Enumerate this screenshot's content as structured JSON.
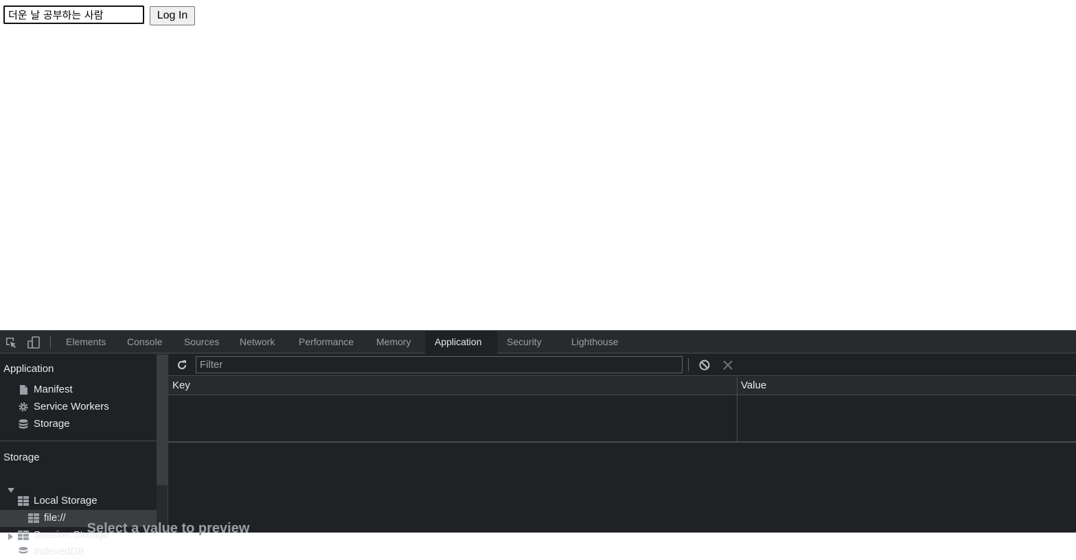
{
  "page": {
    "name_input_value": "더운 날 공부하는 사람",
    "login_button_label": "Log In"
  },
  "devtools": {
    "tabs": [
      {
        "label": "Elements",
        "active": false
      },
      {
        "label": "Console",
        "active": false
      },
      {
        "label": "Sources",
        "active": false
      },
      {
        "label": "Network",
        "active": false
      },
      {
        "label": "Performance",
        "active": false
      },
      {
        "label": "Memory",
        "active": false
      },
      {
        "label": "Application",
        "active": true
      },
      {
        "label": "Security",
        "active": false
      },
      {
        "label": "Lighthouse",
        "active": false
      }
    ],
    "sidebar": {
      "application_header": "Application",
      "application_items": [
        {
          "label": "Manifest",
          "icon": "document-icon"
        },
        {
          "label": "Service Workers",
          "icon": "gear-icon"
        },
        {
          "label": "Storage",
          "icon": "database-icon"
        }
      ],
      "storage_header": "Storage",
      "storage_items": [
        {
          "label": "Local Storage",
          "icon": "table-icon",
          "expanded": true
        },
        {
          "label": "file://",
          "icon": "table-icon",
          "selected": true
        },
        {
          "label": "Session Storage",
          "icon": "table-icon",
          "expanded": false
        },
        {
          "label": "IndexedDB",
          "icon": "database-icon"
        }
      ]
    },
    "main": {
      "filter_placeholder": "Filter",
      "columns": [
        "Key",
        "Value"
      ],
      "preview_text": "Select a value to preview"
    },
    "colors": {
      "panel_bg": "#202124",
      "tab_bar_bg": "#292a2d",
      "active_tab_text": "#e8eaed",
      "inactive_tab_text": "#9aa0a6"
    }
  }
}
